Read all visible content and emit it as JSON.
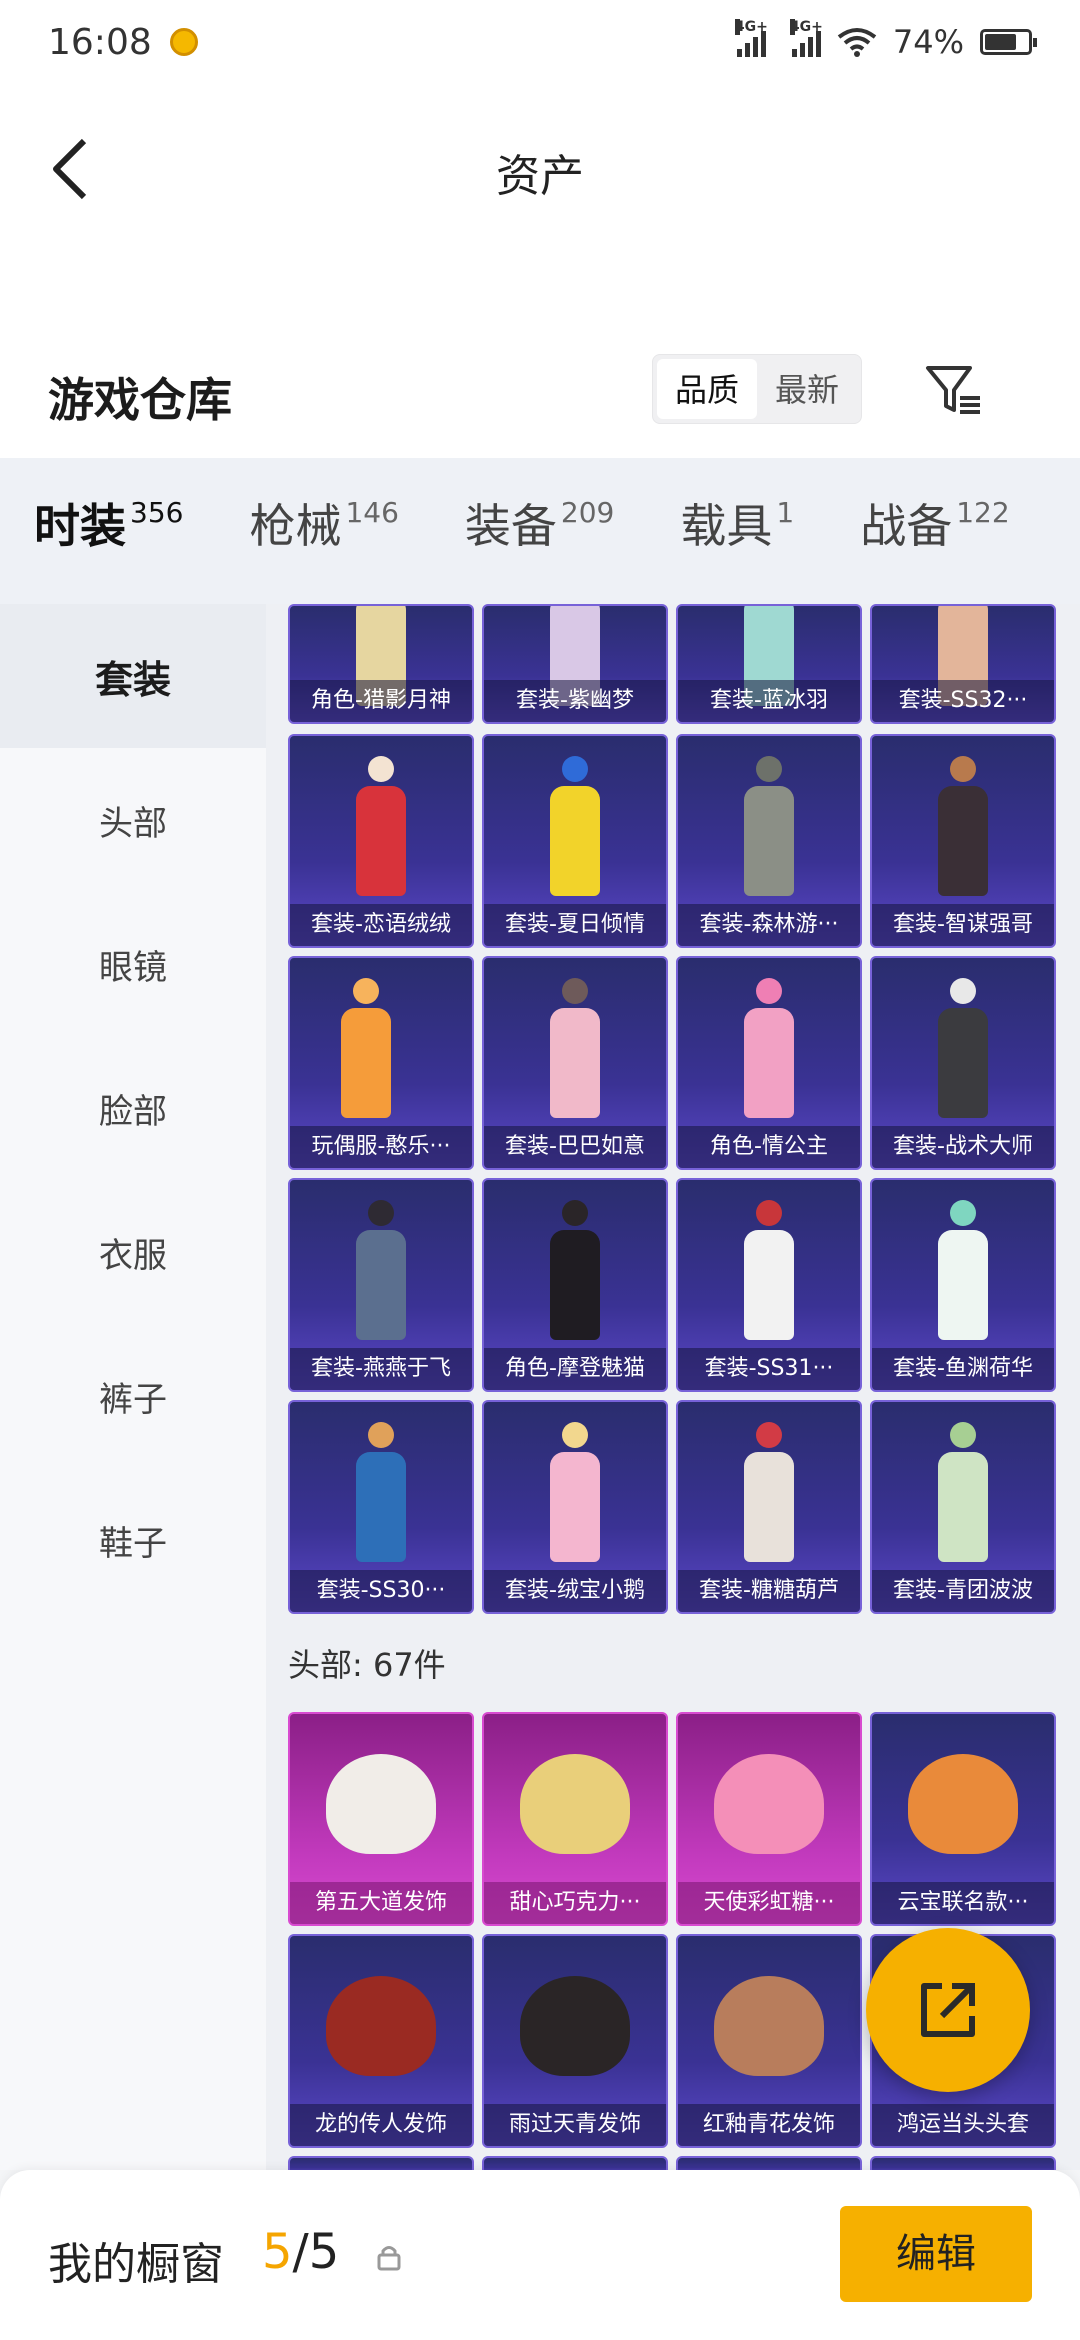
{
  "status": {
    "time": "16:08",
    "net1": "4G+",
    "net2": "4G+",
    "battery": "74%",
    "battery_level": 0.74
  },
  "nav": {
    "title": "资产"
  },
  "section": {
    "title": "游戏仓库",
    "sort_options": [
      "品质",
      "最新"
    ],
    "active_sort": "品质"
  },
  "tabs": [
    {
      "label": "时装",
      "count": "356",
      "active": true
    },
    {
      "label": "枪械",
      "count": "146"
    },
    {
      "label": "装备",
      "count": "209"
    },
    {
      "label": "载具",
      "count": "1"
    },
    {
      "label": "战备",
      "count": "122"
    }
  ],
  "sidebar": {
    "items": [
      "套装",
      "头部",
      "眼镜",
      "脸部",
      "衣服",
      "裤子",
      "鞋子"
    ],
    "active": "套装"
  },
  "outfits": {
    "row0": [
      "角色-猎影月神",
      "套装-紫幽梦",
      "套装-蓝冰羽",
      "套装-SS32···"
    ],
    "rows": [
      [
        "套装-恋语绒绒",
        "套装-夏日倾情",
        "套装-森林游···",
        "套装-智谋强哥"
      ],
      [
        "玩偶服-憨乐···",
        "套装-巴巴如意",
        "角色-情公主",
        "套装-战术大师"
      ],
      [
        "套装-燕燕于飞",
        "角色-摩登魅猫",
        "套装-SS31···",
        "套装-鱼渊荷华"
      ],
      [
        "套装-SS30···",
        "套装-绒宝小鹅",
        "套装-糖糖葫芦",
        "套装-青团波波"
      ]
    ]
  },
  "head": {
    "label": "头部: 67件",
    "rows": [
      [
        "第五大道发饰",
        "甜心巧克力···",
        "天使彩虹糖···",
        "云宝联名款···"
      ],
      [
        "龙的传人发饰",
        "雨过天青发饰",
        "红釉青花发饰",
        "鸿运当头头套"
      ]
    ]
  },
  "bottom": {
    "label": "我的橱窗",
    "count_current": "5",
    "count_total": "/5",
    "edit_label": "编辑"
  }
}
